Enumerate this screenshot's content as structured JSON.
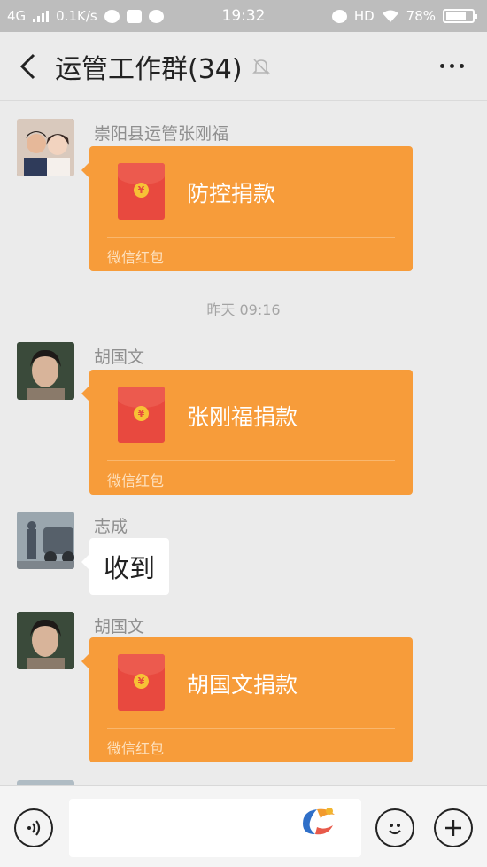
{
  "status_bar": {
    "network": "4G",
    "speed": "0.1K/s",
    "time": "19:32",
    "hd": "HD",
    "battery": "78%",
    "battery_level": 0.78
  },
  "header": {
    "title": "运管工作群(34)"
  },
  "messages": [
    {
      "sender": "崇阳县运管张刚福",
      "type": "red_packet",
      "title": "防控捐款",
      "footer": "微信红包"
    },
    {
      "type": "timestamp",
      "text": "昨天 09:16"
    },
    {
      "sender": "胡国文",
      "type": "red_packet",
      "title": "张刚福捐款",
      "footer": "微信红包"
    },
    {
      "sender": "志成",
      "type": "text",
      "text": "收到"
    },
    {
      "sender": "胡国文",
      "type": "red_packet",
      "title": "胡国文捐款",
      "footer": "微信红包"
    },
    {
      "sender": "志成",
      "type": "partial"
    }
  ],
  "colors": {
    "red_packet": "#f79c3a",
    "envelope": "#e8493f",
    "background": "#ebebeb"
  },
  "icons": {
    "back": "chevron-left-icon",
    "mute": "bell-off-icon",
    "more": "more-dots-icon",
    "voice": "voice-icon",
    "emoji": "emoji-icon",
    "add": "plus-circle-icon"
  },
  "red_packet_symbol": "¥"
}
